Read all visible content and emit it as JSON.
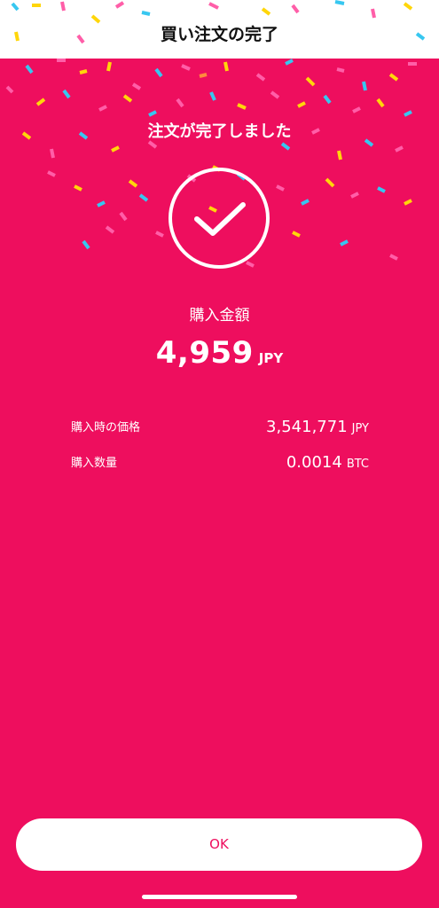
{
  "header": {
    "title": "買い注文の完了"
  },
  "result": {
    "message": "注文が完了しました",
    "amount_label": "購入金額",
    "amount_value": "4,959",
    "amount_unit": "JPY"
  },
  "details": [
    {
      "label": "購入時の価格",
      "value": "3,541,771",
      "unit": "JPY"
    },
    {
      "label": "購入数量",
      "value": "0.0014",
      "unit": "BTC"
    }
  ],
  "actions": {
    "ok_label": "OK"
  },
  "colors": {
    "accent": "#EE0E5E",
    "surface": "#FFFFFF"
  },
  "icons": {
    "status": "checkmark-circle-icon",
    "decoration": "confetti"
  }
}
